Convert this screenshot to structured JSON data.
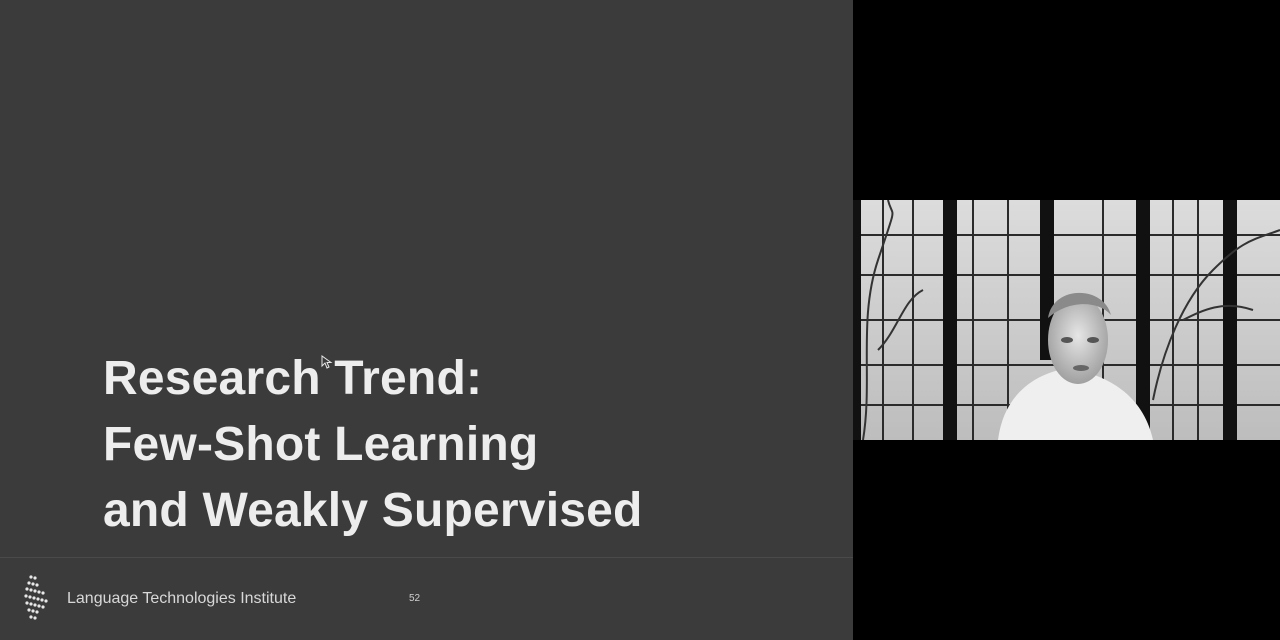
{
  "slide": {
    "title_lines": [
      "Research Trend:",
      "Few-Shot Learning",
      "and Weakly Supervised"
    ],
    "footer_text": "Language Technologies Institute",
    "number": "52",
    "background": "#3b3b3b",
    "title_color": "#ededed"
  },
  "webcam": {
    "icon": "presenter-video"
  }
}
